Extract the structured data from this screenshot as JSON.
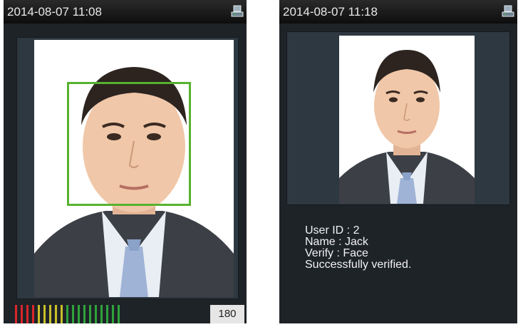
{
  "left_screen": {
    "timestamp": "2014-08-07 11:08",
    "level_value": "180",
    "level_segments": [
      "#d9262b",
      "#d9262b",
      "#d9262b",
      "#d9262b",
      "#c9c02a",
      "#c9c02a",
      "#c9c02a",
      "#c9c02a",
      "#c9c02a",
      "#2fa33b",
      "#2fa33b",
      "#2fa33b",
      "#2fa33b",
      "#2fa33b",
      "#2fa33b",
      "#2fa33b",
      "#2fa33b",
      "#2fa33b",
      "#2fa33b"
    ]
  },
  "right_screen": {
    "timestamp": "2014-08-07 11:18",
    "verification": {
      "user_id": "User ID : 2",
      "name": "Name : Jack",
      "verify": "Verify : Face",
      "status": "Successfully verified."
    }
  },
  "icons": {
    "status_corner": "network-icon"
  },
  "colors": {
    "face_box": "#57b22f",
    "background": "#1e2328"
  }
}
